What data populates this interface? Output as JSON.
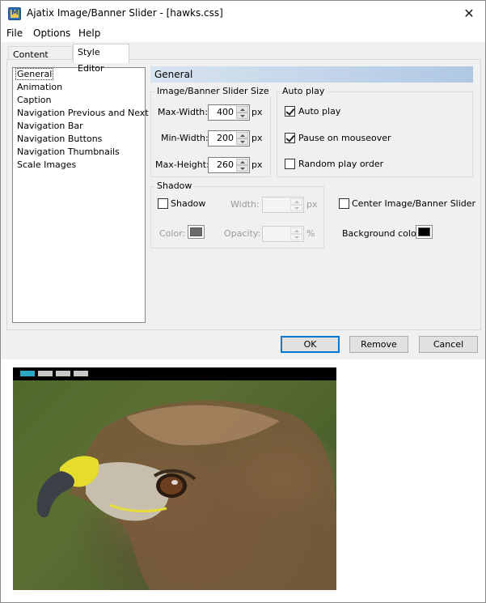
{
  "window": {
    "title": "Ajatix Image/Banner Slider - [hawks.css]",
    "close_glyph": "✕"
  },
  "menu": {
    "file": "File",
    "options": "Options",
    "help": "Help"
  },
  "tabs": {
    "content_editor": "Content Editor",
    "style_editor": "Style Editor"
  },
  "sidebar": {
    "items": [
      "General",
      "Animation",
      "Caption",
      "Navigation Previous and Next",
      "Navigation Bar",
      "Navigation Buttons",
      "Navigation Thumbnails",
      "Scale Images"
    ]
  },
  "section": {
    "title": "General"
  },
  "size_group": {
    "label": "Image/Banner Slider Size",
    "max_width_label": "Max-Width:",
    "max_width": "400",
    "min_width_label": "Min-Width:",
    "min_width": "200",
    "max_height_label": "Max-Height:",
    "max_height": "260",
    "unit": "px"
  },
  "autoplay_group": {
    "label": "Auto play",
    "auto_play": "Auto play",
    "auto_play_checked": true,
    "pause_on_mouseover": "Pause on mouseover",
    "pause_checked": true,
    "random_play_order": "Random play order",
    "random_checked": false
  },
  "shadow_group": {
    "label": "Shadow",
    "shadow": "Shadow",
    "shadow_checked": false,
    "width_label": "Width:",
    "width_value": "",
    "width_unit": "px",
    "color_label": "Color:",
    "color": "#6b6b6b",
    "opacity_label": "Opacity:",
    "opacity_value": "",
    "opacity_unit": "%"
  },
  "misc": {
    "center_slider": "Center Image/Banner Slider",
    "center_checked": false,
    "background_color_label": "Background color:",
    "background_color": "#000000"
  },
  "buttons": {
    "ok": "OK",
    "remove": "Remove",
    "cancel": "Cancel"
  },
  "preview": {
    "nav_active_color": "#2aa7c3",
    "nav_thumb_count": 4,
    "active_index": 0
  }
}
